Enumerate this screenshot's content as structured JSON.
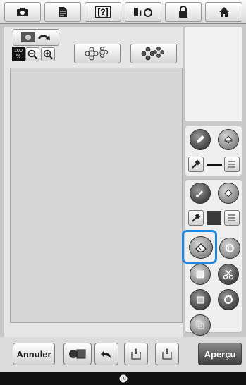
{
  "toolbar": {
    "items": [
      {
        "icon": "camera-icon"
      },
      {
        "icon": "document-icon"
      },
      {
        "icon": "help-icon",
        "label": "[?]"
      },
      {
        "icon": "language-icon"
      },
      {
        "icon": "lock-icon"
      },
      {
        "icon": "home-icon"
      }
    ]
  },
  "zoom": {
    "level": "100",
    "unit": "%"
  },
  "bottom": {
    "annuler_label": "Annuler",
    "apercu_label": "Aperçu"
  },
  "colors": {
    "highlight": "#1e88e5",
    "canvas": "#d6d6d6"
  }
}
